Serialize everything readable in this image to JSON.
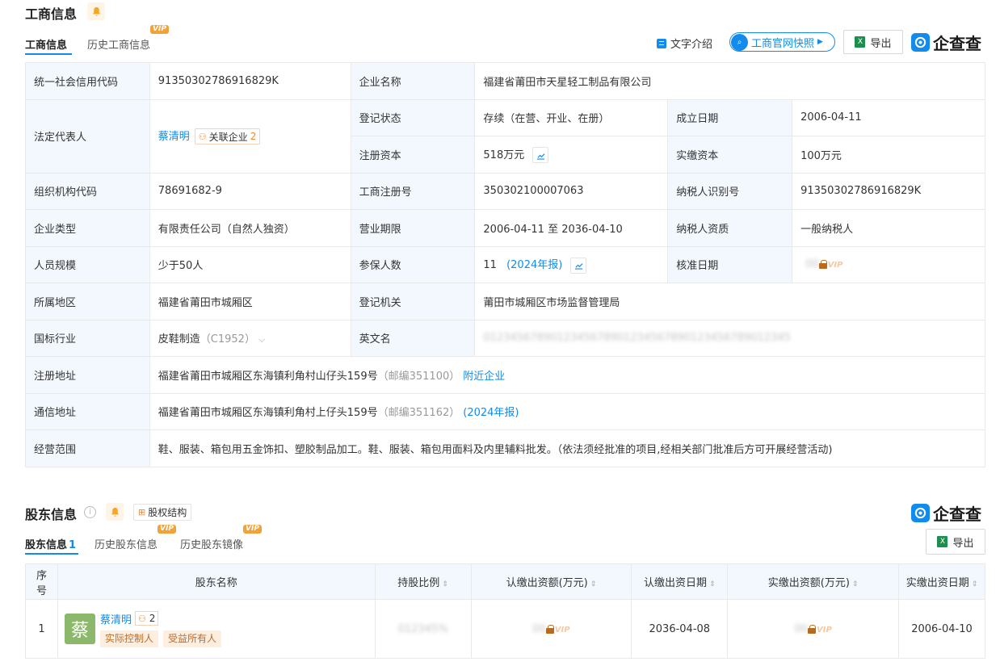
{
  "section1": {
    "title": "工商信息",
    "tabs": [
      "工商信息",
      "历史工商信息"
    ],
    "vip_label": "VIP",
    "actions": {
      "text_intro": "文字介绍",
      "snapshot": "工商官网快照",
      "export": "导出"
    },
    "brand": "企查查"
  },
  "info": {
    "credit_code_label": "统一社会信用代码",
    "credit_code": "91350302786916829K",
    "company_name_label": "企业名称",
    "company_name": "福建省莆田市天星轻工制品有限公司",
    "legal_rep_label": "法定代表人",
    "legal_rep": "蔡清明",
    "assoc_label": "关联企业",
    "assoc_count": "2",
    "reg_status_label": "登记状态",
    "reg_status": "存续（在营、开业、在册）",
    "est_date_label": "成立日期",
    "est_date": "2006-04-11",
    "reg_capital_label": "注册资本",
    "reg_capital": "518万元",
    "paid_capital_label": "实缴资本",
    "paid_capital": "100万元",
    "org_code_label": "组织机构代码",
    "org_code": "78691682-9",
    "reg_no_label": "工商注册号",
    "reg_no": "350302100007063",
    "taxpayer_id_label": "纳税人识别号",
    "taxpayer_id": "91350302786916829K",
    "type_label": "企业类型",
    "type": "有限责任公司（自然人独资）",
    "term_label": "营业期限",
    "term": "2006-04-11 至 2036-04-10",
    "tax_qual_label": "纳税人资质",
    "tax_qual": "一般纳税人",
    "staff_label": "人员规模",
    "staff": "少于50人",
    "insured_label": "参保人数",
    "insured": "11",
    "insured_note": "(2024年报)",
    "approve_label": "核准日期",
    "region_label": "所属地区",
    "region": "福建省莆田市城厢区",
    "authority_label": "登记机关",
    "authority": "莆田市城厢区市场监督管理局",
    "industry_label": "国标行业",
    "industry": "皮鞋制造",
    "industry_code": "（C1952）",
    "eng_name_label": "英文名",
    "reg_addr_label": "注册地址",
    "reg_addr": "福建省莆田市城厢区东海镇利角村山仔头159号",
    "reg_zip": "（邮编351100）",
    "nearby": "附近企业",
    "mail_addr_label": "通信地址",
    "mail_addr": "福建省莆田市城厢区东海镇利角村上仔头159号",
    "mail_zip": "（邮编351162）",
    "mail_note": "(2024年报)",
    "scope_label": "经营范围",
    "scope": "鞋、服装、箱包用五金饰扣、塑胶制品加工。鞋、服装、箱包用面料及内里辅料批发。（依法须经批准的项目,经相关部门批准后方可开展经营活动)"
  },
  "section2": {
    "title": "股东信息",
    "equity_btn": "股权结构",
    "tabs": [
      "股东信息",
      "历史股东信息",
      "历史股东镜像"
    ],
    "tab_count": "1",
    "export": "导出",
    "brand": "企查查",
    "columns": [
      "序号",
      "股东名称",
      "持股比例",
      "认缴出资额(万元)",
      "认缴出资日期",
      "实缴出资额(万元)",
      "实缴出资日期"
    ],
    "rows": [
      {
        "index": "1",
        "avatar": "蔡",
        "name": "蔡清明",
        "count": "2",
        "tags": [
          "实际控制人",
          "受益所有人"
        ],
        "sub_date": "2036-04-08",
        "paid_date": "2006-04-10"
      }
    ]
  }
}
